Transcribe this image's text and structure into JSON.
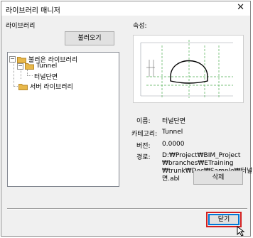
{
  "window": {
    "title": "라이브러리 매니저",
    "close_glyph": "✕"
  },
  "library_panel": {
    "label": "라이브러리",
    "load_button": "불러오기",
    "tree": {
      "expander_glyph": "−",
      "loaded_library": "불러온 라이브러리",
      "tunnel": "Tunnel",
      "tunnel_section": "터널단면",
      "user_library": "서버 라이브러리"
    }
  },
  "properties": {
    "label": "속성:",
    "name_label": "이름:",
    "name_value": "터널단면",
    "category_label": "카테고리:",
    "category_value": "Tunnel",
    "version_label": "버전:",
    "version_value": "0.0000",
    "path_label": "경로:",
    "path_lines": [
      "D:₩Project₩BIM_Project",
      "₩branches₩ETraining",
      "₩trunk₩Doc₩Sample₩터널단",
      "면.abl"
    ],
    "delete_button": "삭제"
  },
  "footer": {
    "close_button": "닫기"
  },
  "colors": {
    "accent": "#0078d7",
    "highlight": "#d32020",
    "folder": "#e8b84a"
  },
  "icons": [
    "folder-icon",
    "close-icon",
    "expander-icon",
    "cursor-icon"
  ]
}
